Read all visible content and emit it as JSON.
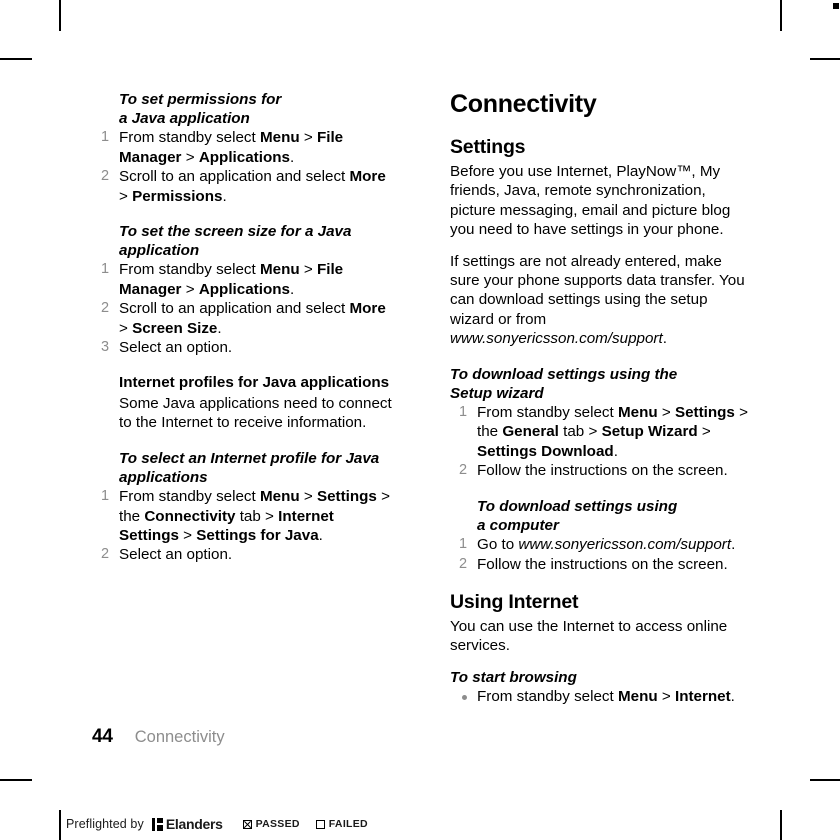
{
  "page": {
    "folio": "44",
    "chapter": "Connectivity"
  },
  "left_column": {
    "proc_permissions": {
      "heading_line1": "To set permissions for",
      "heading_line2": "a Java application",
      "steps": [
        "From standby select Menu > File Manager > Applications.",
        "Scroll to an application and select More > Permissions."
      ]
    },
    "proc_screen_size": {
      "heading_line1": "To set the screen size for a Java",
      "heading_line2": "application",
      "steps": [
        "From standby select Menu > File Manager > Applications.",
        "Scroll to an application and select More > Screen Size.",
        "Select an option."
      ]
    },
    "internet_profiles": {
      "heading": "Internet profiles for Java applications",
      "body": "Some Java applications need to connect to the Internet to receive information."
    },
    "proc_select_profile": {
      "heading_line1": "To select an Internet profile for Java",
      "heading_line2": "applications",
      "steps": [
        "From standby select Menu > the Connectivity tab > Internet Settings > Settings for Java.",
        "Select an option."
      ]
    }
  },
  "right_column": {
    "chapter_title": "Connectivity",
    "settings": {
      "heading": "Settings",
      "paragraph1": "Before you use Internet, PlayNow™, My friends, Java, remote synchronization, picture messaging, email and picture blog you need to have settings in your phone.",
      "paragraph2": "If settings are not already entered, make sure your phone supports data transfer. You can download settings using the setup wizard or from www.sonyericsson.com/support."
    },
    "proc_setup_wizard": {
      "heading_line1": "To download settings using the",
      "heading_line2": "Setup wizard",
      "steps": [
        "From standby select Menu > Settings > the General tab > Setup Wizard > Settings Download.",
        "Follow the instructions on the screen."
      ]
    },
    "proc_computer": {
      "heading_line1": "To download settings using",
      "heading_line2": "a computer",
      "steps": [
        "Go to www.sonyericsson.com/support.",
        "Follow the instructions on the screen."
      ]
    },
    "using_internet": {
      "heading": "Using Internet",
      "body": "You can use the Internet to access online services.",
      "proc_start_browsing": {
        "heading": "To start browsing",
        "bullet": "From standby select Menu > Internet."
      }
    }
  },
  "preflight": {
    "text": "Preflighted by",
    "brand": "Elanders",
    "passed_label": "PASSED",
    "failed_label": "FAILED",
    "passed_checked": true,
    "failed_checked": false
  },
  "colors": {
    "ink": "#000000",
    "muted": "#8d8d8d",
    "page": "#ffffff"
  }
}
